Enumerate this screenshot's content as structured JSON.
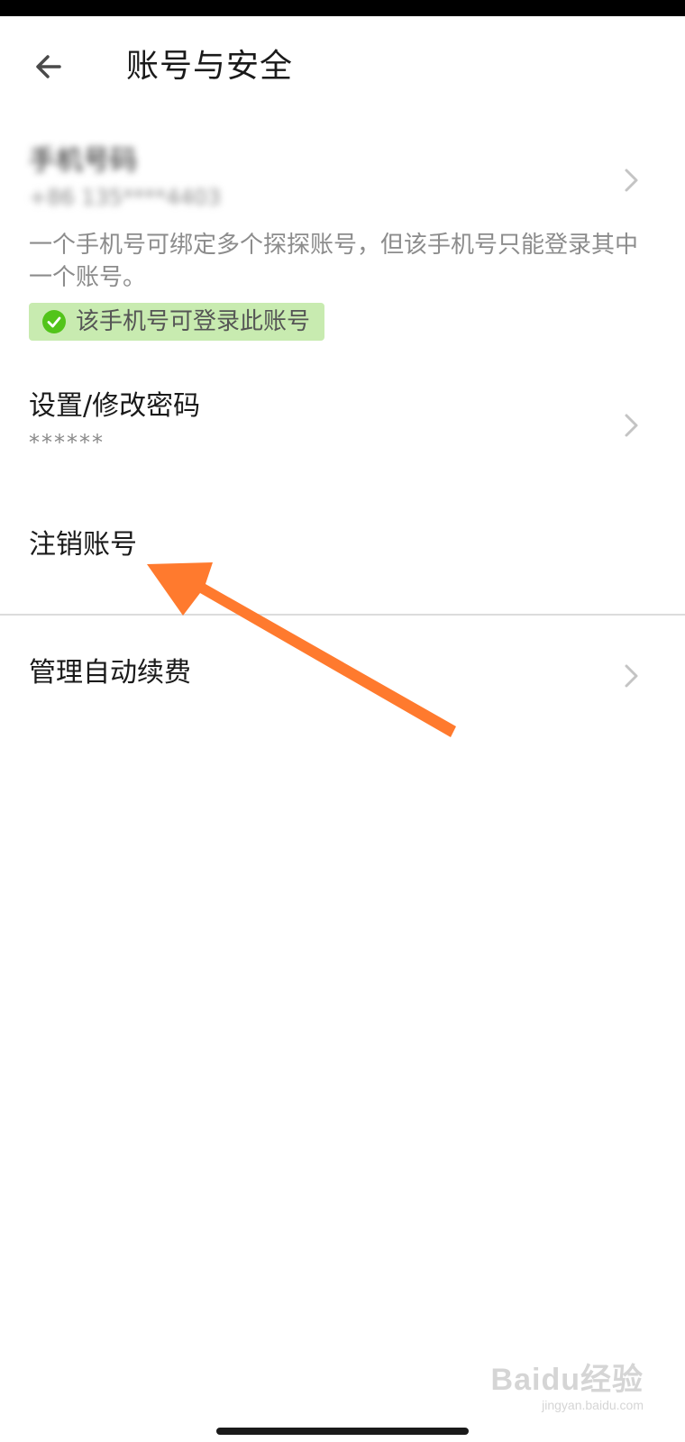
{
  "header": {
    "title": "账号与安全"
  },
  "phone": {
    "label": "手机号码",
    "value": "+86 135****4403",
    "description": "一个手机号可绑定多个探探账号，但该手机号只能登录其中一个账号。",
    "badge": "该手机号可登录此账号"
  },
  "password": {
    "label": "设置/修改密码",
    "value": "******"
  },
  "deactivate": {
    "label": "注销账号"
  },
  "auto_renew": {
    "label": "管理自动续费"
  },
  "watermark": {
    "main": "Baidu经验",
    "sub": "jingyan.baidu.com"
  },
  "colors": {
    "annotation_arrow": "#ff7a2e",
    "badge_bg": "#c8ebb0",
    "badge_check": "#52c41a"
  }
}
